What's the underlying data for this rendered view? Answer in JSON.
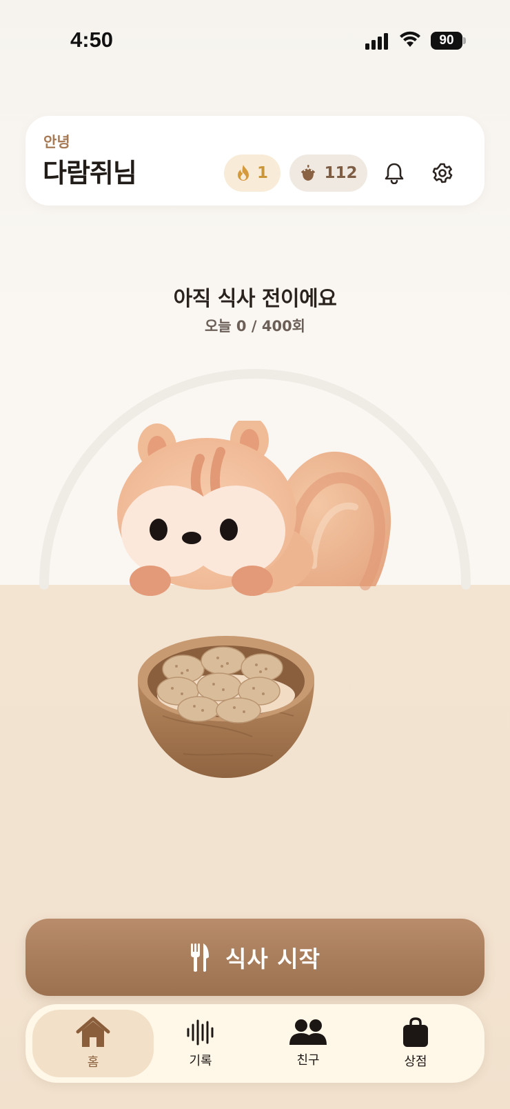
{
  "status_bar": {
    "time": "4:50",
    "battery": "90"
  },
  "header": {
    "greeting": "안녕",
    "user_name": "다람쥐님",
    "streak_count": "1",
    "acorn_count": "112"
  },
  "meal": {
    "title": "아직 식사 전이에요",
    "count_label": "오늘 0 / 400회",
    "progress": 0
  },
  "start_button": {
    "label": "식사 시작"
  },
  "tabs": [
    {
      "label": "홈",
      "icon": "home-icon",
      "active": true
    },
    {
      "label": "기록",
      "icon": "waveform-icon",
      "active": false
    },
    {
      "label": "친구",
      "icon": "people-icon",
      "active": false
    },
    {
      "label": "상점",
      "icon": "shopping-bag-icon",
      "active": false
    }
  ],
  "colors": {
    "accent": "#a97e5c",
    "streak": "#c9963a",
    "background": "#f9f6f1",
    "floor": "#f2e3d0",
    "tab_active": "#f2e1c8"
  }
}
